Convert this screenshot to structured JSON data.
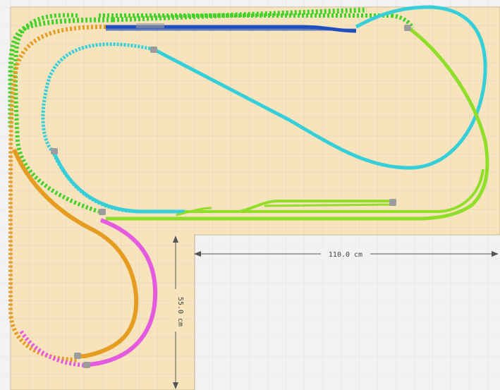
{
  "window": {
    "title": ""
  },
  "colors": {
    "board": "#f7e4bd",
    "board_border": "#c9b78f",
    "empty_area": "#f2f2f2",
    "grid": "#c8c8c8",
    "track_cyan": "#36cfd9",
    "track_green": "#90dd2a",
    "track_bright_green": "#43d22a",
    "track_orange": "#e59c21",
    "track_magenta": "#e55be0",
    "track_blue": "#1f4fbf",
    "buffer_gray": "#9c9c9c",
    "dimension_line": "#555555"
  },
  "dimensions": {
    "width_label": "110.0 cm",
    "height_label": "55.0 cm"
  },
  "tracks": [
    {
      "id": "cyan-loop",
      "color_key": "track_cyan",
      "style": "solid"
    },
    {
      "id": "cyan-upper",
      "color_key": "track_cyan",
      "style": "dashed"
    },
    {
      "id": "green-siding",
      "color_key": "track_green",
      "style": "solid"
    },
    {
      "id": "green-outer",
      "color_key": "track_bright_green",
      "style": "dashed"
    },
    {
      "id": "orange-loop",
      "color_key": "track_orange",
      "style": "solid"
    },
    {
      "id": "orange-outer",
      "color_key": "track_orange",
      "style": "dashed"
    },
    {
      "id": "magenta-loop",
      "color_key": "track_magenta",
      "style": "solid"
    },
    {
      "id": "blue-siding",
      "color_key": "track_blue",
      "style": "solid"
    }
  ],
  "icons": {
    "buffer_stop": "buffer-stop-icon",
    "arrow": "dimension-arrow-icon"
  }
}
